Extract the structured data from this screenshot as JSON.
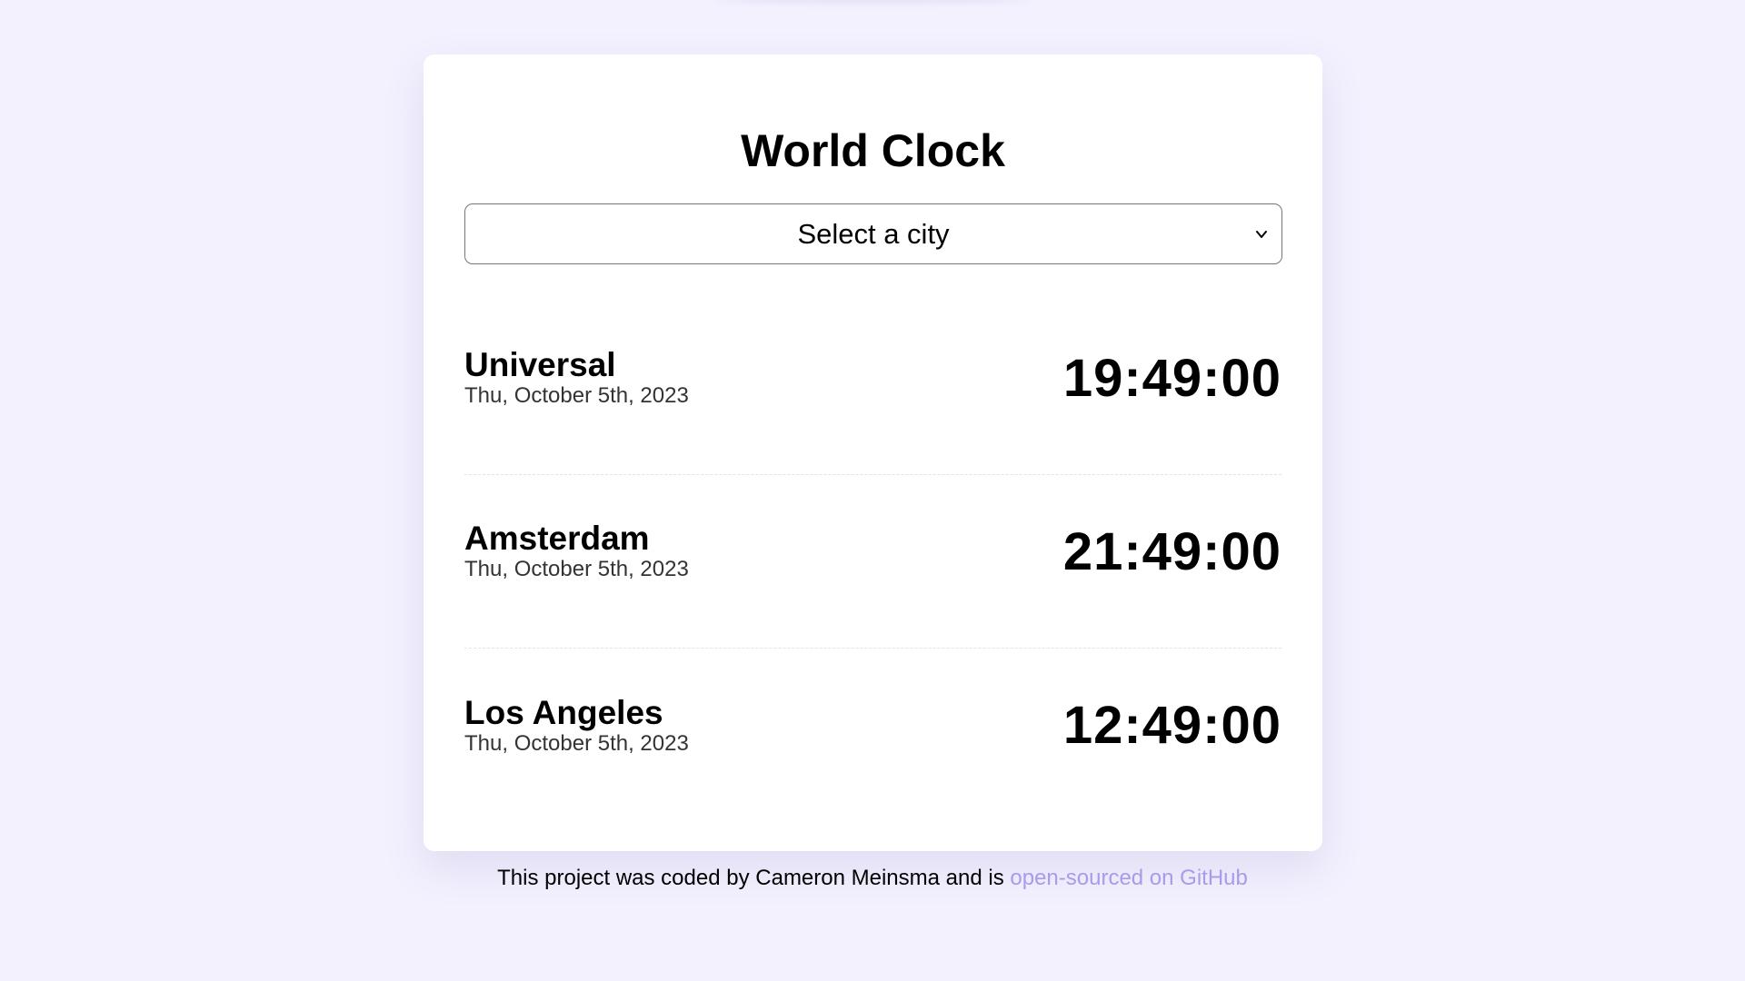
{
  "app": {
    "title": "World Clock"
  },
  "city_select": {
    "selected": "Select a city"
  },
  "cities": [
    {
      "name": "Universal",
      "date": "Thu, October 5th, 2023",
      "time": "19:49:00"
    },
    {
      "name": "Amsterdam",
      "date": "Thu, October 5th, 2023",
      "time": "21:49:00"
    },
    {
      "name": "Los Angeles",
      "date": "Thu, October 5th, 2023",
      "time": "12:49:00"
    }
  ],
  "footer": {
    "text": "This project was coded by Cameron Meinsma and is ",
    "link_label": "open-sourced on GitHub",
    "link_color": "#a99bea"
  },
  "colors": {
    "background": "#f3f1fe",
    "card": "#ffffff"
  }
}
